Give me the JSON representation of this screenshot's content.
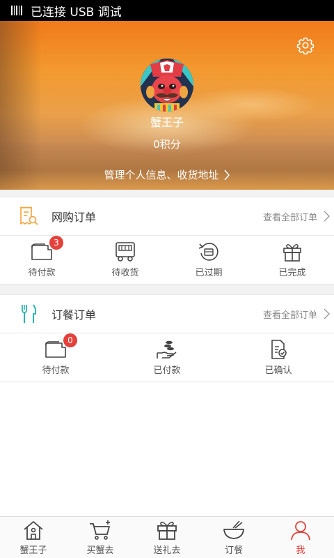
{
  "status_bar": {
    "text": "已连接 USB 调试"
  },
  "profile": {
    "username": "蟹王子",
    "points": "0积分",
    "manage_link": "管理个人信息、收货地址"
  },
  "online_orders": {
    "title": "网购订单",
    "view_all": "查看全部订单",
    "items": [
      {
        "label": "待付款",
        "badge": "3"
      },
      {
        "label": "待收货"
      },
      {
        "label": "已过期"
      },
      {
        "label": "已完成"
      }
    ]
  },
  "meal_orders": {
    "title": "订餐订单",
    "view_all": "查看全部订单",
    "items": [
      {
        "label": "待付款",
        "badge": "0"
      },
      {
        "label": "已付款"
      },
      {
        "label": "已确认"
      }
    ]
  },
  "bottom_nav": {
    "tabs": [
      {
        "label": "蟹王子",
        "icon": "home-icon"
      },
      {
        "label": "买蟹去",
        "icon": "cart-icon"
      },
      {
        "label": "送礼去",
        "icon": "gift-icon"
      },
      {
        "label": "订餐",
        "icon": "bowl-icon"
      },
      {
        "label": "我",
        "icon": "user-icon",
        "active": true
      }
    ]
  },
  "colors": {
    "accent": "#f39a30",
    "badge": "#e3413b",
    "active_tab": "#e3413b",
    "online_icon": "#f3a238",
    "meal_icon": "#2bb5b0"
  }
}
